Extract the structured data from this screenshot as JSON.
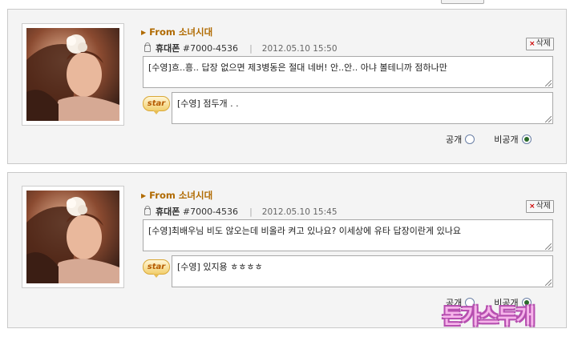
{
  "entries": [
    {
      "from_label": "From 소녀시대",
      "sender": "휴대폰",
      "number": "#7000-4536",
      "date": "2012.05.10 15:50",
      "delete_label": "삭제",
      "message": "[수영]흐..흥.. 답장 없으면 제3병동은 절대 네버! 안..안.. 아냐 볼테니까 점하나만",
      "reply_badge": "star",
      "reply": "[수영] 점두개 . .",
      "public_label": "공개",
      "private_label": "비공개",
      "selected": "private"
    },
    {
      "from_label": "From 소녀시대",
      "sender": "휴대폰",
      "number": "#7000-4536",
      "date": "2012.05.10 15:45",
      "delete_label": "삭제",
      "message": "[수영]최배우님 비도 않오는데 비올라 켜고 있나요? 이세상에 유타 답장이란게 있나요",
      "reply_badge": "star",
      "reply": "[수영] 있지용 ㅎㅎㅎㅎ",
      "public_label": "공개",
      "private_label": "비공개",
      "selected": "private"
    }
  ],
  "watermark": "돈가스두개",
  "colors": {
    "from": "#b06a00",
    "card_bg": "#f4f4f4",
    "watermark": "#f6b4ea"
  }
}
